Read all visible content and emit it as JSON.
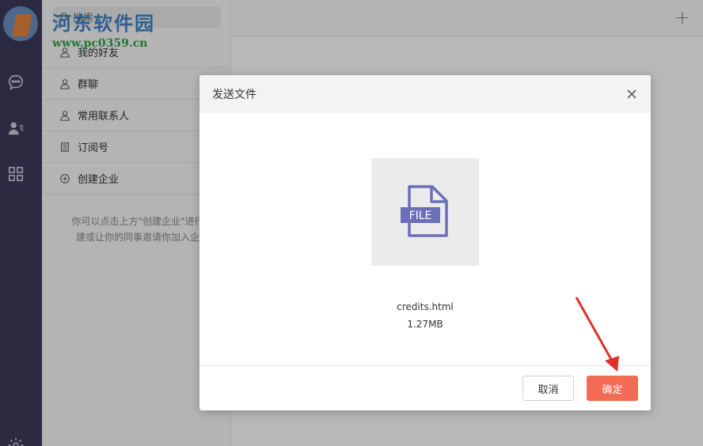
{
  "watermark": {
    "title": "河东软件园",
    "url": "www.pc0359.cn"
  },
  "rail": {
    "icons": [
      "chat-bubble-icon",
      "contacts-icon",
      "apps-grid-icon",
      "settings-icon"
    ]
  },
  "search": {
    "label": "搜索"
  },
  "contacts": {
    "items": [
      {
        "label": "我的好友",
        "icon": "user-icon"
      },
      {
        "label": "群聊",
        "icon": "user-icon"
      },
      {
        "label": "常用联系人",
        "icon": "user-icon"
      },
      {
        "label": "订阅号",
        "icon": "book-icon"
      },
      {
        "label": "创建企业",
        "icon": "plus-circle-icon"
      }
    ],
    "hint_line1": "你可以点击上方\"创建企业\"进行创",
    "hint_line2": "建或让你的同事邀请你加入企业"
  },
  "topbar": {
    "plus": "+"
  },
  "dialog": {
    "title": "发送文件",
    "file_label": "FILE",
    "file_name": "credits.html",
    "file_size": "1.27MB",
    "cancel_label": "取消",
    "ok_label": "确定"
  },
  "colors": {
    "rail": "#3e3b5b",
    "accent": "#f26b55",
    "file_icon": "#6b6fb8",
    "annotation_arrow": "#e0322a"
  }
}
